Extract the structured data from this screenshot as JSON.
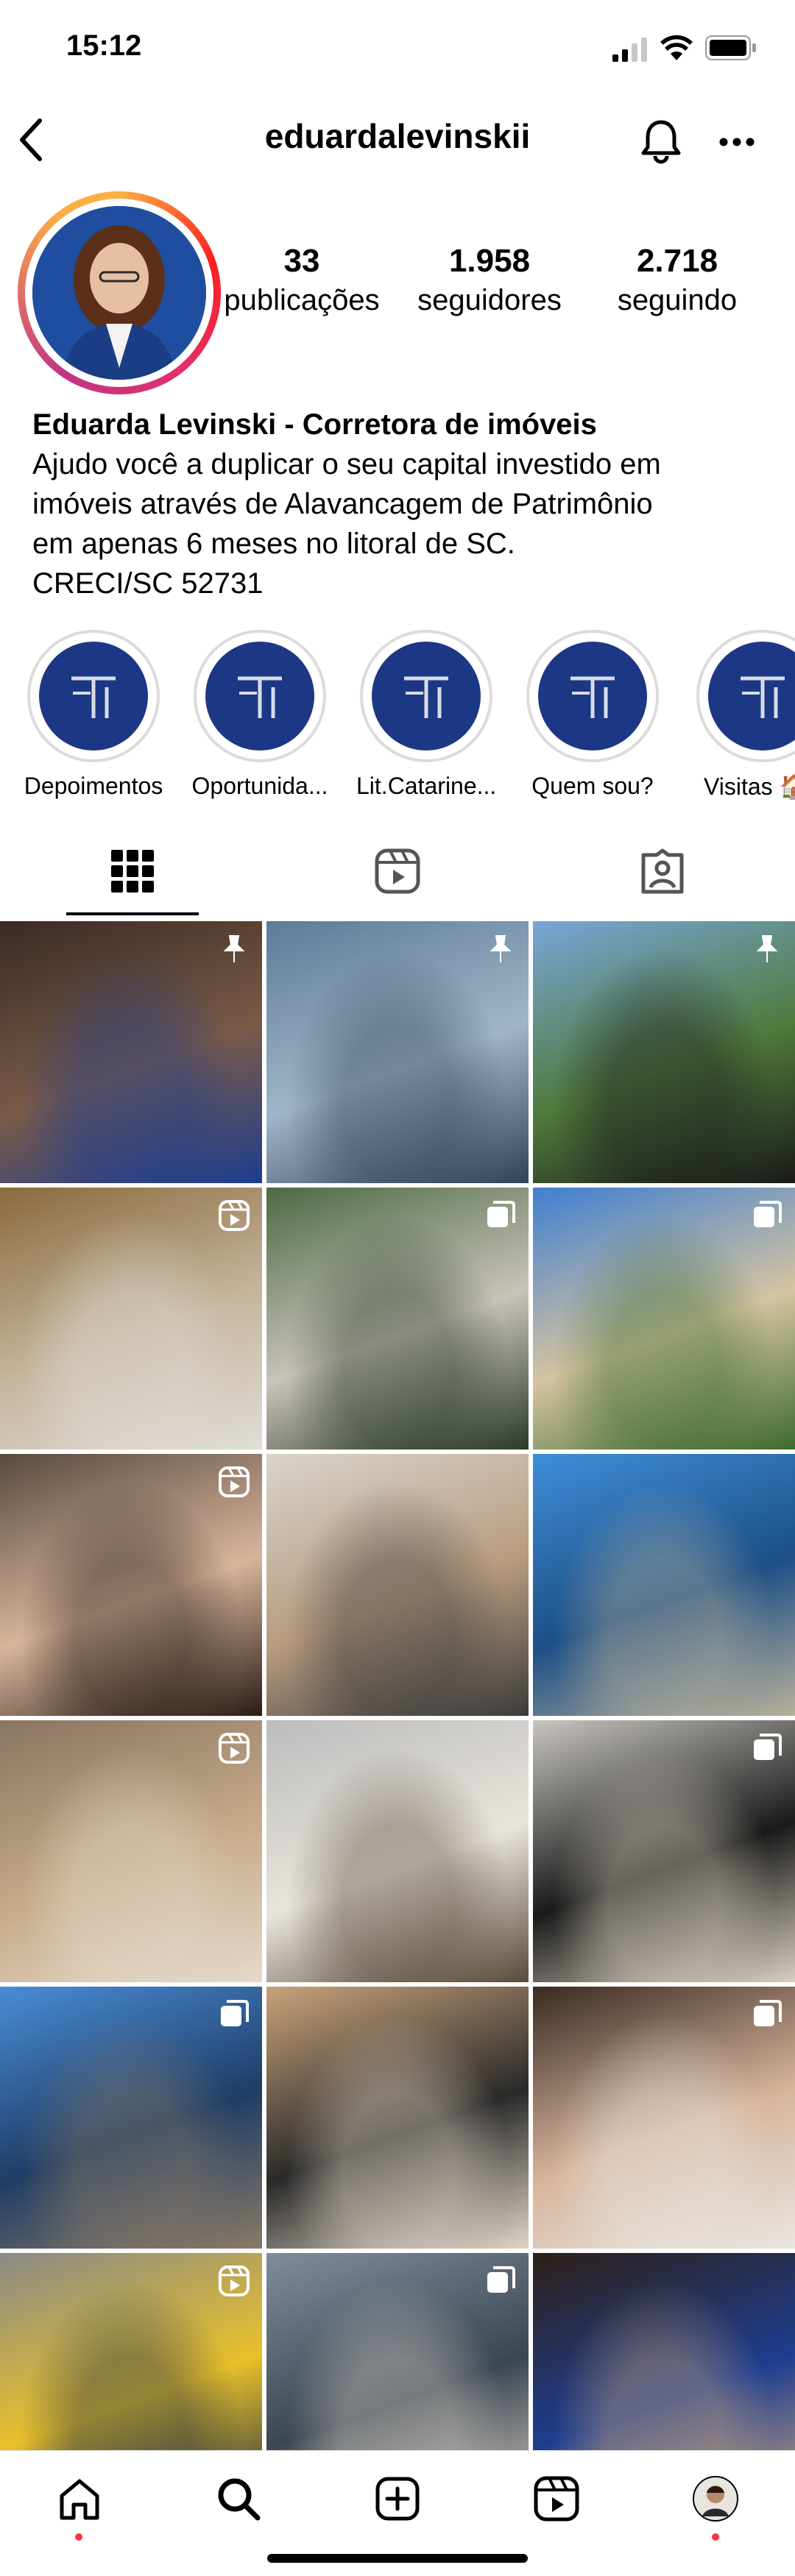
{
  "status": {
    "time": "15:12"
  },
  "header": {
    "username": "eduardalevinskii"
  },
  "profile": {
    "stats": [
      {
        "value": "33",
        "label": "publicações"
      },
      {
        "value": "1.958",
        "label": "seguidores"
      },
      {
        "value": "2.718",
        "label": "seguindo"
      }
    ],
    "name": "Eduarda Levinski - Corretora de imóveis",
    "bio_lines": [
      "Ajudo você a duplicar o seu capital investido em",
      "imóveis através de Alavancagem de Patrimônio",
      "em apenas 6 meses no litoral de SC.",
      "CRECI/SC 52731"
    ]
  },
  "highlights": [
    {
      "label": "Depoimentos"
    },
    {
      "label": "Oportunida..."
    },
    {
      "label": "Lit.Catarine..."
    },
    {
      "label": "Quem sou?"
    },
    {
      "label": "Visitas 🏠"
    }
  ],
  "tabs": [
    {
      "icon": "grid-icon"
    },
    {
      "icon": "reels-icon"
    },
    {
      "icon": "tagged-icon"
    }
  ],
  "posts": [
    {
      "badge": "pin",
      "desc": "Mulher em terno azul em restaurante",
      "colors": [
        "#3a2a22",
        "#7a5a48",
        "#1d3d8f"
      ]
    },
    {
      "badge": "pin",
      "desc": "Prédio de vidro com logo",
      "colors": [
        "#5d7b97",
        "#9fb6c9",
        "#2f4457"
      ]
    },
    {
      "badge": "pin",
      "desc": "Mulher de blusa preta em jardim",
      "colors": [
        "#79a6d8",
        "#4f7a3c",
        "#1a1a1a"
      ]
    },
    {
      "badge": "reel",
      "desc": "Área de lazer com poltronas",
      "colors": [
        "#8a6a3e",
        "#c6b59c",
        "#e0ddd8"
      ]
    },
    {
      "badge": "multi",
      "desc": "Mulher em cadeira suspensa",
      "colors": [
        "#4d6a43",
        "#c9c3ba",
        "#2a3a2a"
      ]
    },
    {
      "badge": "multi",
      "desc": "Torre residencial com palmeiras",
      "colors": [
        "#3f7fd0",
        "#d5c3a1",
        "#3d6b2e"
      ]
    },
    {
      "badge": "reel",
      "desc": "Selfie com óculos",
      "colors": [
        "#5a4a3e",
        "#d7b59c",
        "#2a1c14"
      ]
    },
    {
      "badge": "none",
      "desc": "Mulher lendo catálogo em escritório",
      "colors": [
        "#d9d4cb",
        "#b89b7f",
        "#3b3b3b"
      ]
    },
    {
      "badge": "none",
      "desc": "Mulher com capacete em frente ao mar",
      "colors": [
        "#3f8ed8",
        "#1c4f86",
        "#b8b09a"
      ]
    },
    {
      "badge": "reel",
      "desc": "Brinde com champanhe",
      "colors": [
        "#8b7560",
        "#c7ab8a",
        "#e6dacb"
      ]
    },
    {
      "badge": "none",
      "desc": "Bíblia aberta",
      "colors": [
        "#bcbcbc",
        "#e8e4dc",
        "#5a4a3a"
      ]
    },
    {
      "badge": "multi",
      "desc": "Casal em escritório",
      "colors": [
        "#c8c5bf",
        "#1a1a1a",
        "#d8cfc0"
      ]
    },
    {
      "badge": "multi",
      "desc": "Mulher em canteiro de obras",
      "colors": [
        "#4a8cd6",
        "#1f3d66",
        "#8a7a66"
      ]
    },
    {
      "badge": "none",
      "desc": "Entrega de chaves",
      "colors": [
        "#c9a27a",
        "#2a2a2a",
        "#e0d5c6"
      ]
    },
    {
      "badge": "multi",
      "desc": "Selfie com celular",
      "colors": [
        "#3a2a22",
        "#d7b59c",
        "#e9e5e0"
      ]
    },
    {
      "badge": "reel",
      "desc": "Mulher com capacete amarelo",
      "colors": [
        "#8a8a88",
        "#e8c02a",
        "#1c2a44"
      ]
    },
    {
      "badge": "multi",
      "desc": "Maquete de empreendimento",
      "colors": [
        "#7f8d9a",
        "#3b4652",
        "#d0c9be"
      ]
    },
    {
      "badge": "none",
      "desc": "Mulher segurando celular em bar",
      "colors": [
        "#2e2018",
        "#1d3d8f",
        "#c9a47f"
      ]
    }
  ],
  "tab_bar": [
    {
      "icon": "home-icon"
    },
    {
      "icon": "search-icon"
    },
    {
      "icon": "create-icon"
    },
    {
      "icon": "reels-icon"
    },
    {
      "icon": "profile-avatar"
    }
  ]
}
